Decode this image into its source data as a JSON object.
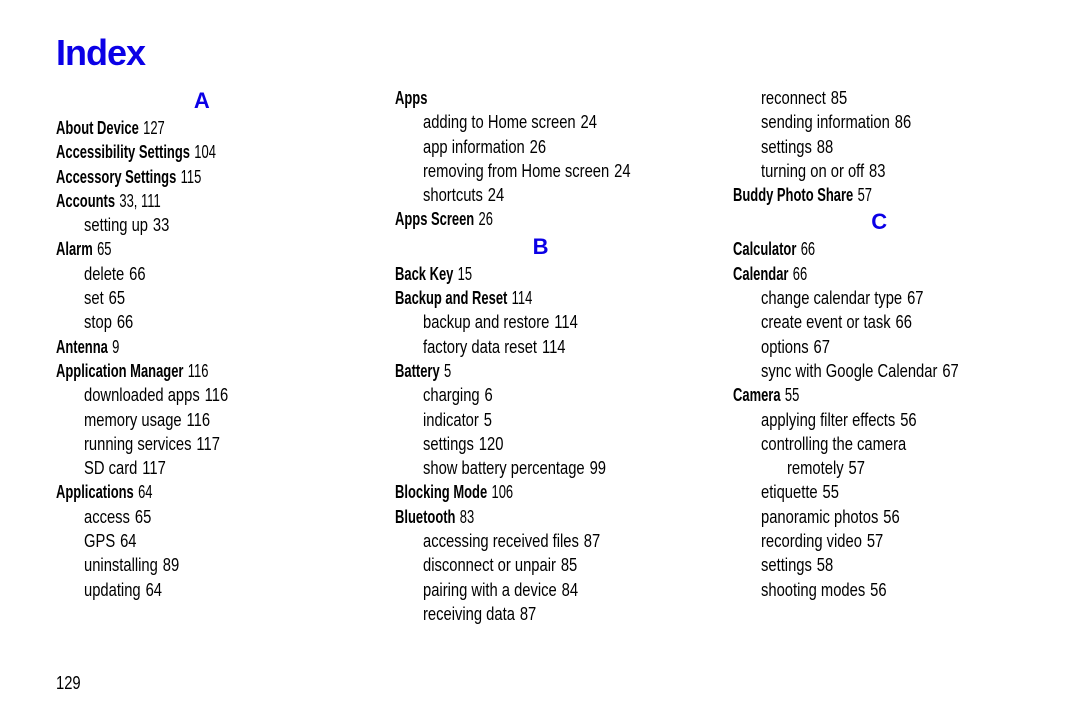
{
  "title": "Index",
  "page_number": "129",
  "columns": [
    {
      "items": [
        {
          "kind": "letter",
          "text": "A"
        },
        {
          "kind": "entry",
          "label": "About Device",
          "pages": "127"
        },
        {
          "kind": "entry",
          "label": "Accessibility Settings",
          "pages": "104"
        },
        {
          "kind": "entry",
          "label": "Accessory Settings",
          "pages": "115"
        },
        {
          "kind": "entry",
          "label": "Accounts",
          "pages": "33, 111"
        },
        {
          "kind": "sub",
          "label": "setting up",
          "pages": "33"
        },
        {
          "kind": "entry",
          "label": "Alarm",
          "pages": "65"
        },
        {
          "kind": "sub",
          "label": "delete",
          "pages": "66"
        },
        {
          "kind": "sub",
          "label": "set",
          "pages": "65"
        },
        {
          "kind": "sub",
          "label": "stop",
          "pages": "66"
        },
        {
          "kind": "entry",
          "label": "Antenna",
          "pages": "9"
        },
        {
          "kind": "entry",
          "label": "Application Manager",
          "pages": "116"
        },
        {
          "kind": "sub",
          "label": "downloaded apps",
          "pages": "116"
        },
        {
          "kind": "sub",
          "label": "memory usage",
          "pages": "116"
        },
        {
          "kind": "sub",
          "label": "running services",
          "pages": "117"
        },
        {
          "kind": "sub",
          "label": "SD card",
          "pages": "117"
        },
        {
          "kind": "entry",
          "label": "Applications",
          "pages": "64"
        },
        {
          "kind": "sub",
          "label": "access",
          "pages": "65"
        },
        {
          "kind": "sub",
          "label": "GPS",
          "pages": "64"
        },
        {
          "kind": "sub",
          "label": "uninstalling",
          "pages": "89"
        },
        {
          "kind": "sub",
          "label": "updating",
          "pages": "64"
        }
      ]
    },
    {
      "items": [
        {
          "kind": "entry",
          "label": "Apps",
          "pages": ""
        },
        {
          "kind": "sub",
          "label": "adding to Home screen",
          "pages": "24"
        },
        {
          "kind": "sub",
          "label": "app information",
          "pages": "26"
        },
        {
          "kind": "sub",
          "label": "removing from Home screen",
          "pages": "24"
        },
        {
          "kind": "sub",
          "label": "shortcuts",
          "pages": "24"
        },
        {
          "kind": "entry",
          "label": "Apps Screen",
          "pages": "26"
        },
        {
          "kind": "letter",
          "text": "B"
        },
        {
          "kind": "entry",
          "label": "Back Key",
          "pages": "15"
        },
        {
          "kind": "entry",
          "label": "Backup and Reset",
          "pages": "114"
        },
        {
          "kind": "sub",
          "label": "backup and restore",
          "pages": "114"
        },
        {
          "kind": "sub",
          "label": "factory data reset",
          "pages": "114"
        },
        {
          "kind": "entry",
          "label": "Battery",
          "pages": "5"
        },
        {
          "kind": "sub",
          "label": "charging",
          "pages": "6"
        },
        {
          "kind": "sub",
          "label": "indicator",
          "pages": "5"
        },
        {
          "kind": "sub",
          "label": "settings",
          "pages": "120"
        },
        {
          "kind": "sub",
          "label": "show battery percentage",
          "pages": "99"
        },
        {
          "kind": "entry",
          "label": "Blocking Mode",
          "pages": "106"
        },
        {
          "kind": "entry",
          "label": "Bluetooth",
          "pages": "83"
        },
        {
          "kind": "sub",
          "label": "accessing received files",
          "pages": "87"
        },
        {
          "kind": "sub",
          "label": "disconnect or unpair",
          "pages": "85"
        },
        {
          "kind": "sub",
          "label": "pairing with a device",
          "pages": "84"
        },
        {
          "kind": "sub",
          "label": "receiving data",
          "pages": "87"
        }
      ]
    },
    {
      "items": [
        {
          "kind": "sub",
          "label": "reconnect",
          "pages": "85"
        },
        {
          "kind": "sub",
          "label": "sending information",
          "pages": "86"
        },
        {
          "kind": "sub",
          "label": "settings",
          "pages": "88"
        },
        {
          "kind": "sub",
          "label": "turning on or off",
          "pages": "83"
        },
        {
          "kind": "entry",
          "label": "Buddy Photo Share",
          "pages": "57"
        },
        {
          "kind": "letter",
          "text": "C"
        },
        {
          "kind": "entry",
          "label": "Calculator",
          "pages": "66"
        },
        {
          "kind": "entry",
          "label": "Calendar",
          "pages": "66"
        },
        {
          "kind": "sub",
          "label": "change calendar type",
          "pages": "67"
        },
        {
          "kind": "sub",
          "label": "create event or task",
          "pages": "66"
        },
        {
          "kind": "sub",
          "label": "options",
          "pages": "67"
        },
        {
          "kind": "sub",
          "label": "sync with Google Calendar",
          "pages": "67"
        },
        {
          "kind": "entry",
          "label": "Camera",
          "pages": "55"
        },
        {
          "kind": "sub",
          "label": "applying filter effects",
          "pages": "56"
        },
        {
          "kind": "sub",
          "label": "controlling the camera",
          "pages": ""
        },
        {
          "kind": "subcont",
          "label": "remotely",
          "pages": "57"
        },
        {
          "kind": "sub",
          "label": "etiquette",
          "pages": "55"
        },
        {
          "kind": "sub",
          "label": "panoramic photos",
          "pages": "56"
        },
        {
          "kind": "sub",
          "label": "recording video",
          "pages": "57"
        },
        {
          "kind": "sub",
          "label": "settings",
          "pages": "58"
        },
        {
          "kind": "sub",
          "label": "shooting modes",
          "pages": "56"
        }
      ]
    }
  ]
}
